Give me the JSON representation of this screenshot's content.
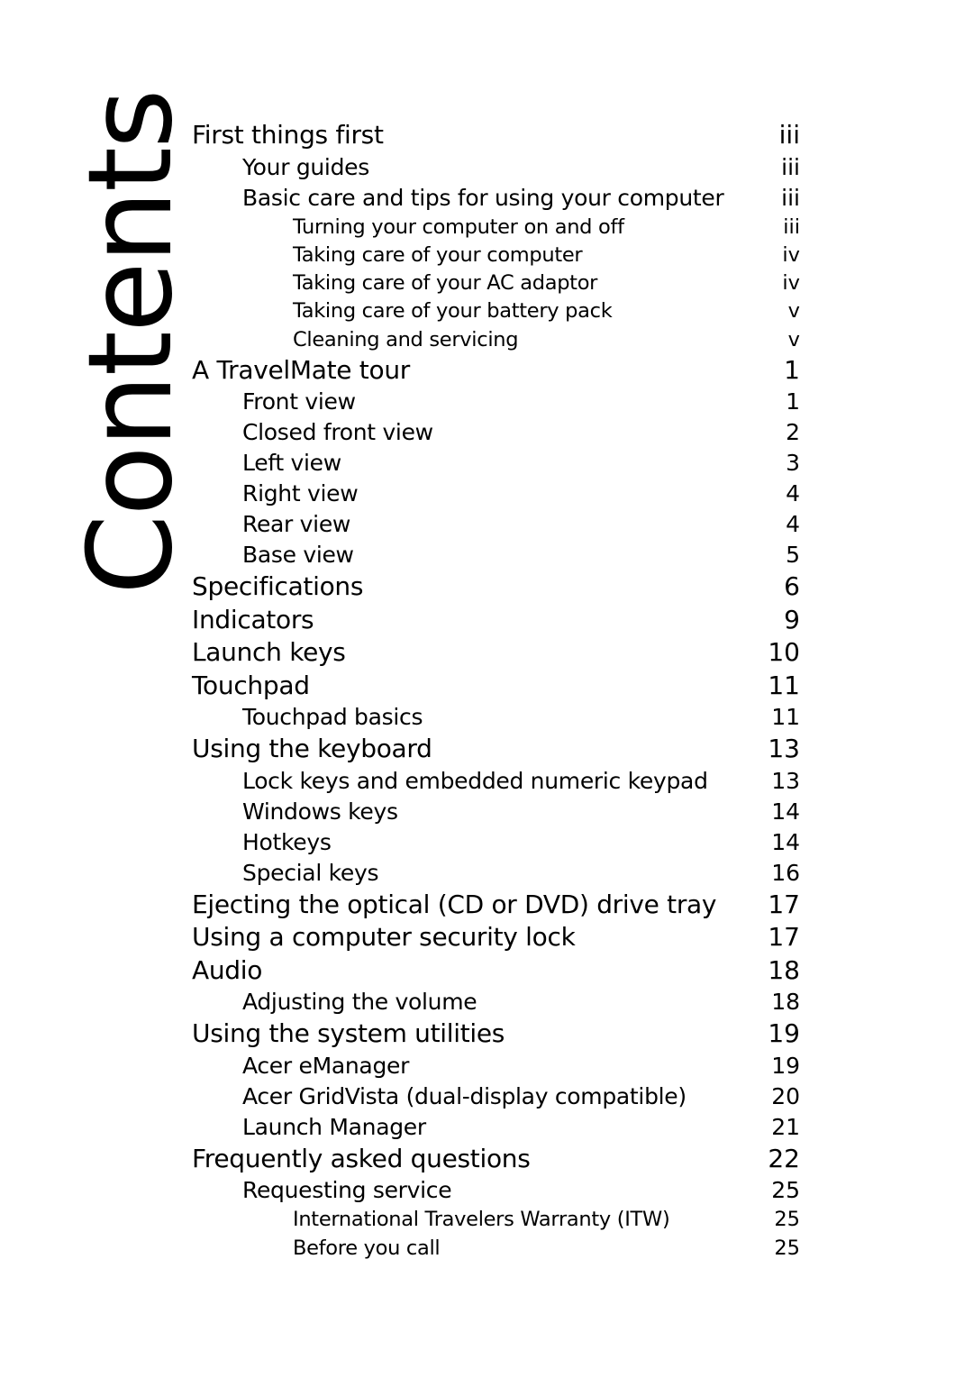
{
  "page_title": "Contents",
  "toc": [
    {
      "level": 1,
      "label": "First things first",
      "page": "iii"
    },
    {
      "level": 2,
      "label": "Your guides",
      "page": "iii"
    },
    {
      "level": 2,
      "label": "Basic care and tips for using your computer",
      "page": "iii"
    },
    {
      "level": 3,
      "label": "Turning your computer on and off",
      "page": "iii"
    },
    {
      "level": 3,
      "label": "Taking care of your computer",
      "page": "iv"
    },
    {
      "level": 3,
      "label": "Taking care of your AC adaptor",
      "page": "iv"
    },
    {
      "level": 3,
      "label": "Taking care of your battery pack",
      "page": "v"
    },
    {
      "level": 3,
      "label": "Cleaning and servicing",
      "page": "v"
    },
    {
      "level": 1,
      "label": "A TravelMate tour",
      "page": "1"
    },
    {
      "level": 2,
      "label": "Front view",
      "page": "1"
    },
    {
      "level": 2,
      "label": "Closed front view",
      "page": "2"
    },
    {
      "level": 2,
      "label": "Left view",
      "page": "3"
    },
    {
      "level": 2,
      "label": "Right view",
      "page": "4"
    },
    {
      "level": 2,
      "label": "Rear view",
      "page": "4"
    },
    {
      "level": 2,
      "label": "Base view",
      "page": "5"
    },
    {
      "level": 1,
      "label": "Specifications",
      "page": "6"
    },
    {
      "level": 1,
      "label": "Indicators",
      "page": "9"
    },
    {
      "level": 1,
      "label": "Launch keys",
      "page": "10"
    },
    {
      "level": 1,
      "label": "Touchpad",
      "page": "11"
    },
    {
      "level": 2,
      "label": "Touchpad basics",
      "page": "11"
    },
    {
      "level": 1,
      "label": "Using the keyboard",
      "page": "13"
    },
    {
      "level": 2,
      "label": "Lock keys and embedded numeric keypad",
      "page": "13"
    },
    {
      "level": 2,
      "label": "Windows keys",
      "page": "14"
    },
    {
      "level": 2,
      "label": "Hotkeys",
      "page": "14"
    },
    {
      "level": 2,
      "label": "Special keys",
      "page": "16"
    },
    {
      "level": 1,
      "label": "Ejecting the optical (CD or DVD) drive tray",
      "page": "17"
    },
    {
      "level": 1,
      "label": "Using a computer security lock",
      "page": "17"
    },
    {
      "level": 1,
      "label": "Audio",
      "page": "18"
    },
    {
      "level": 2,
      "label": "Adjusting the volume",
      "page": "18"
    },
    {
      "level": 1,
      "label": "Using the system utilities",
      "page": "19"
    },
    {
      "level": 2,
      "label": "Acer eManager",
      "page": "19"
    },
    {
      "level": 2,
      "label": "Acer GridVista (dual-display compatible)",
      "page": "20"
    },
    {
      "level": 2,
      "label": "Launch Manager",
      "page": "21"
    },
    {
      "level": 1,
      "label": "Frequently asked questions",
      "page": "22"
    },
    {
      "level": 2,
      "label": "Requesting service",
      "page": "25"
    },
    {
      "level": 3,
      "label": "International Travelers Warranty (ITW)",
      "page": "25"
    },
    {
      "level": 3,
      "label": "Before you call",
      "page": "25"
    }
  ]
}
